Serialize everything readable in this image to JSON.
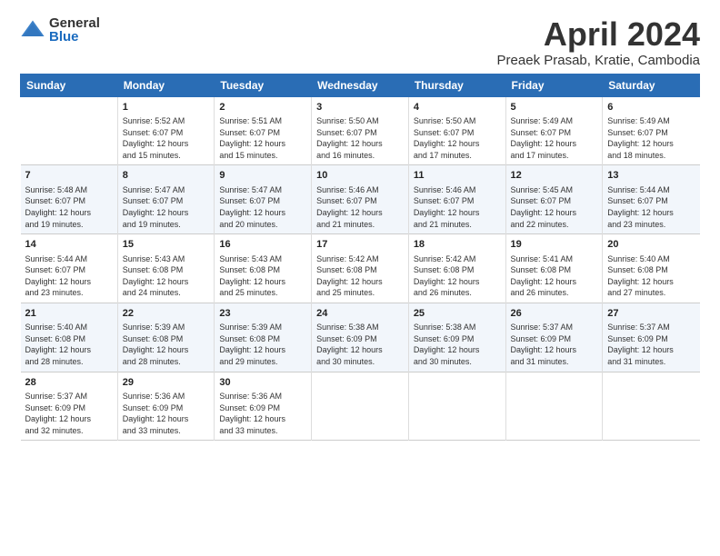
{
  "header": {
    "logo_general": "General",
    "logo_blue": "Blue",
    "title": "April 2024",
    "location": "Preaek Prasab, Kratie, Cambodia"
  },
  "columns": [
    "Sunday",
    "Monday",
    "Tuesday",
    "Wednesday",
    "Thursday",
    "Friday",
    "Saturday"
  ],
  "weeks": [
    [
      {
        "day": "",
        "info": ""
      },
      {
        "day": "1",
        "info": "Sunrise: 5:52 AM\nSunset: 6:07 PM\nDaylight: 12 hours\nand 15 minutes."
      },
      {
        "day": "2",
        "info": "Sunrise: 5:51 AM\nSunset: 6:07 PM\nDaylight: 12 hours\nand 15 minutes."
      },
      {
        "day": "3",
        "info": "Sunrise: 5:50 AM\nSunset: 6:07 PM\nDaylight: 12 hours\nand 16 minutes."
      },
      {
        "day": "4",
        "info": "Sunrise: 5:50 AM\nSunset: 6:07 PM\nDaylight: 12 hours\nand 17 minutes."
      },
      {
        "day": "5",
        "info": "Sunrise: 5:49 AM\nSunset: 6:07 PM\nDaylight: 12 hours\nand 17 minutes."
      },
      {
        "day": "6",
        "info": "Sunrise: 5:49 AM\nSunset: 6:07 PM\nDaylight: 12 hours\nand 18 minutes."
      }
    ],
    [
      {
        "day": "7",
        "info": "Sunrise: 5:48 AM\nSunset: 6:07 PM\nDaylight: 12 hours\nand 19 minutes."
      },
      {
        "day": "8",
        "info": "Sunrise: 5:47 AM\nSunset: 6:07 PM\nDaylight: 12 hours\nand 19 minutes."
      },
      {
        "day": "9",
        "info": "Sunrise: 5:47 AM\nSunset: 6:07 PM\nDaylight: 12 hours\nand 20 minutes."
      },
      {
        "day": "10",
        "info": "Sunrise: 5:46 AM\nSunset: 6:07 PM\nDaylight: 12 hours\nand 21 minutes."
      },
      {
        "day": "11",
        "info": "Sunrise: 5:46 AM\nSunset: 6:07 PM\nDaylight: 12 hours\nand 21 minutes."
      },
      {
        "day": "12",
        "info": "Sunrise: 5:45 AM\nSunset: 6:07 PM\nDaylight: 12 hours\nand 22 minutes."
      },
      {
        "day": "13",
        "info": "Sunrise: 5:44 AM\nSunset: 6:07 PM\nDaylight: 12 hours\nand 23 minutes."
      }
    ],
    [
      {
        "day": "14",
        "info": "Sunrise: 5:44 AM\nSunset: 6:07 PM\nDaylight: 12 hours\nand 23 minutes."
      },
      {
        "day": "15",
        "info": "Sunrise: 5:43 AM\nSunset: 6:08 PM\nDaylight: 12 hours\nand 24 minutes."
      },
      {
        "day": "16",
        "info": "Sunrise: 5:43 AM\nSunset: 6:08 PM\nDaylight: 12 hours\nand 25 minutes."
      },
      {
        "day": "17",
        "info": "Sunrise: 5:42 AM\nSunset: 6:08 PM\nDaylight: 12 hours\nand 25 minutes."
      },
      {
        "day": "18",
        "info": "Sunrise: 5:42 AM\nSunset: 6:08 PM\nDaylight: 12 hours\nand 26 minutes."
      },
      {
        "day": "19",
        "info": "Sunrise: 5:41 AM\nSunset: 6:08 PM\nDaylight: 12 hours\nand 26 minutes."
      },
      {
        "day": "20",
        "info": "Sunrise: 5:40 AM\nSunset: 6:08 PM\nDaylight: 12 hours\nand 27 minutes."
      }
    ],
    [
      {
        "day": "21",
        "info": "Sunrise: 5:40 AM\nSunset: 6:08 PM\nDaylight: 12 hours\nand 28 minutes."
      },
      {
        "day": "22",
        "info": "Sunrise: 5:39 AM\nSunset: 6:08 PM\nDaylight: 12 hours\nand 28 minutes."
      },
      {
        "day": "23",
        "info": "Sunrise: 5:39 AM\nSunset: 6:08 PM\nDaylight: 12 hours\nand 29 minutes."
      },
      {
        "day": "24",
        "info": "Sunrise: 5:38 AM\nSunset: 6:09 PM\nDaylight: 12 hours\nand 30 minutes."
      },
      {
        "day": "25",
        "info": "Sunrise: 5:38 AM\nSunset: 6:09 PM\nDaylight: 12 hours\nand 30 minutes."
      },
      {
        "day": "26",
        "info": "Sunrise: 5:37 AM\nSunset: 6:09 PM\nDaylight: 12 hours\nand 31 minutes."
      },
      {
        "day": "27",
        "info": "Sunrise: 5:37 AM\nSunset: 6:09 PM\nDaylight: 12 hours\nand 31 minutes."
      }
    ],
    [
      {
        "day": "28",
        "info": "Sunrise: 5:37 AM\nSunset: 6:09 PM\nDaylight: 12 hours\nand 32 minutes."
      },
      {
        "day": "29",
        "info": "Sunrise: 5:36 AM\nSunset: 6:09 PM\nDaylight: 12 hours\nand 33 minutes."
      },
      {
        "day": "30",
        "info": "Sunrise: 5:36 AM\nSunset: 6:09 PM\nDaylight: 12 hours\nand 33 minutes."
      },
      {
        "day": "",
        "info": ""
      },
      {
        "day": "",
        "info": ""
      },
      {
        "day": "",
        "info": ""
      },
      {
        "day": "",
        "info": ""
      }
    ]
  ]
}
